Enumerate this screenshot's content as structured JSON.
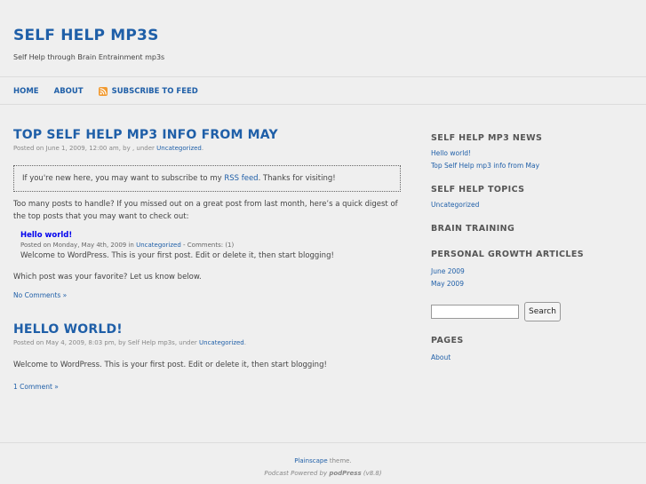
{
  "site": {
    "title": "SELF HELP MP3S",
    "tagline": "Self Help through Brain Entrainment mp3s"
  },
  "nav": {
    "home": "HOME",
    "about": "ABOUT",
    "subscribe": "SUBSCRIBE TO FEED"
  },
  "post1": {
    "title": "TOP SELF HELP MP3 INFO FROM MAY",
    "meta_prefix": "Posted on June 1, 2009, 12:00 am, by , under ",
    "category": "Uncategorized",
    "notice_before": "If you're new here, you may want to subscribe to my ",
    "notice_link": "RSS feed",
    "notice_after": ". Thanks for visiting!",
    "intro": "Too many posts to handle? If you missed out on a great post from last month, here’s a quick digest of the top posts that you may want to check out:",
    "digest_title": "Hello world!",
    "digest_meta_prefix": "Posted on Monday, May 4th, 2009 in ",
    "digest_category": "Uncategorized",
    "digest_meta_suffix": " - Comments: (1)",
    "digest_excerpt": "Welcome to WordPress. This is your first post. Edit or delete it, then start blogging!",
    "closing": "Which post was your favorite? Let us know below.",
    "comments_link": "No Comments »"
  },
  "post2": {
    "title": "HELLO WORLD!",
    "meta_prefix": "Posted on May 4, 2009, 8:03 pm, by Self Help mp3s, under ",
    "category": "Uncategorized",
    "body": "Welcome to WordPress. This is your first post. Edit or delete it, then start blogging!",
    "comments_link": "1 Comment »"
  },
  "sidebar": {
    "news_title": "SELF HELP MP3 NEWS",
    "news_items": [
      "Hello world!",
      "Top Self Help mp3 info from May"
    ],
    "topics_title": "SELF HELP TOPICS",
    "topics_items": [
      "Uncategorized"
    ],
    "brain_title": "BRAIN TRAINING",
    "articles_title": "PERSONAL GROWTH ARTICLES",
    "articles_items": [
      "June 2009",
      "May 2009"
    ],
    "search_value": "",
    "search_button": "Search",
    "pages_title": "PAGES",
    "pages_items": [
      "About"
    ]
  },
  "footer": {
    "theme_link": "Plainscape",
    "theme_suffix": " theme.",
    "podcast_prefix": "Podcast Powered by ",
    "podpress": "podPress",
    "podpress_version": " (v8.8)"
  },
  "colors": {
    "background": "#efefef",
    "link": "#1f5fa8",
    "rss": "#f19a31"
  },
  "icons": {
    "feed": "rss-icon"
  }
}
